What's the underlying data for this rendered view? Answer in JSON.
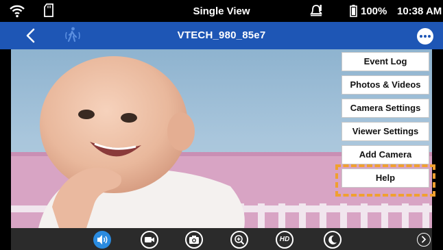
{
  "status_bar": {
    "title": "Single View",
    "battery": "100%",
    "time": "10:38 AM",
    "icons": [
      "wifi-icon",
      "sd-card-icon",
      "alert-icon",
      "battery-icon"
    ]
  },
  "title_bar": {
    "device_name": "VTECH_980_85e7",
    "icons": [
      "back-icon",
      "motion-walk-icon",
      "more-options-icon"
    ]
  },
  "menu": {
    "items": [
      {
        "label": "Event Log"
      },
      {
        "label": "Photos & Videos"
      },
      {
        "label": "Camera Settings"
      },
      {
        "label": "Viewer Settings"
      },
      {
        "label": "Add Camera"
      },
      {
        "label": "Help"
      }
    ],
    "highlighted": "Help",
    "highlight_color": "#f0a030"
  },
  "toolbar": {
    "tools": [
      {
        "name": "speaker-icon",
        "active": true
      },
      {
        "name": "video-record-icon",
        "active": false
      },
      {
        "name": "camera-snapshot-icon",
        "active": false
      },
      {
        "name": "zoom-in-icon",
        "active": false
      },
      {
        "name": "hd-icon",
        "label": "HD",
        "active": false
      },
      {
        "name": "night-mode-icon",
        "active": false
      },
      {
        "name": "next-icon",
        "active": false
      }
    ]
  },
  "colors": {
    "title_bar": "#1e56b5",
    "toolbar": "#2b2b2b",
    "active_tool": "#2a8be0"
  }
}
